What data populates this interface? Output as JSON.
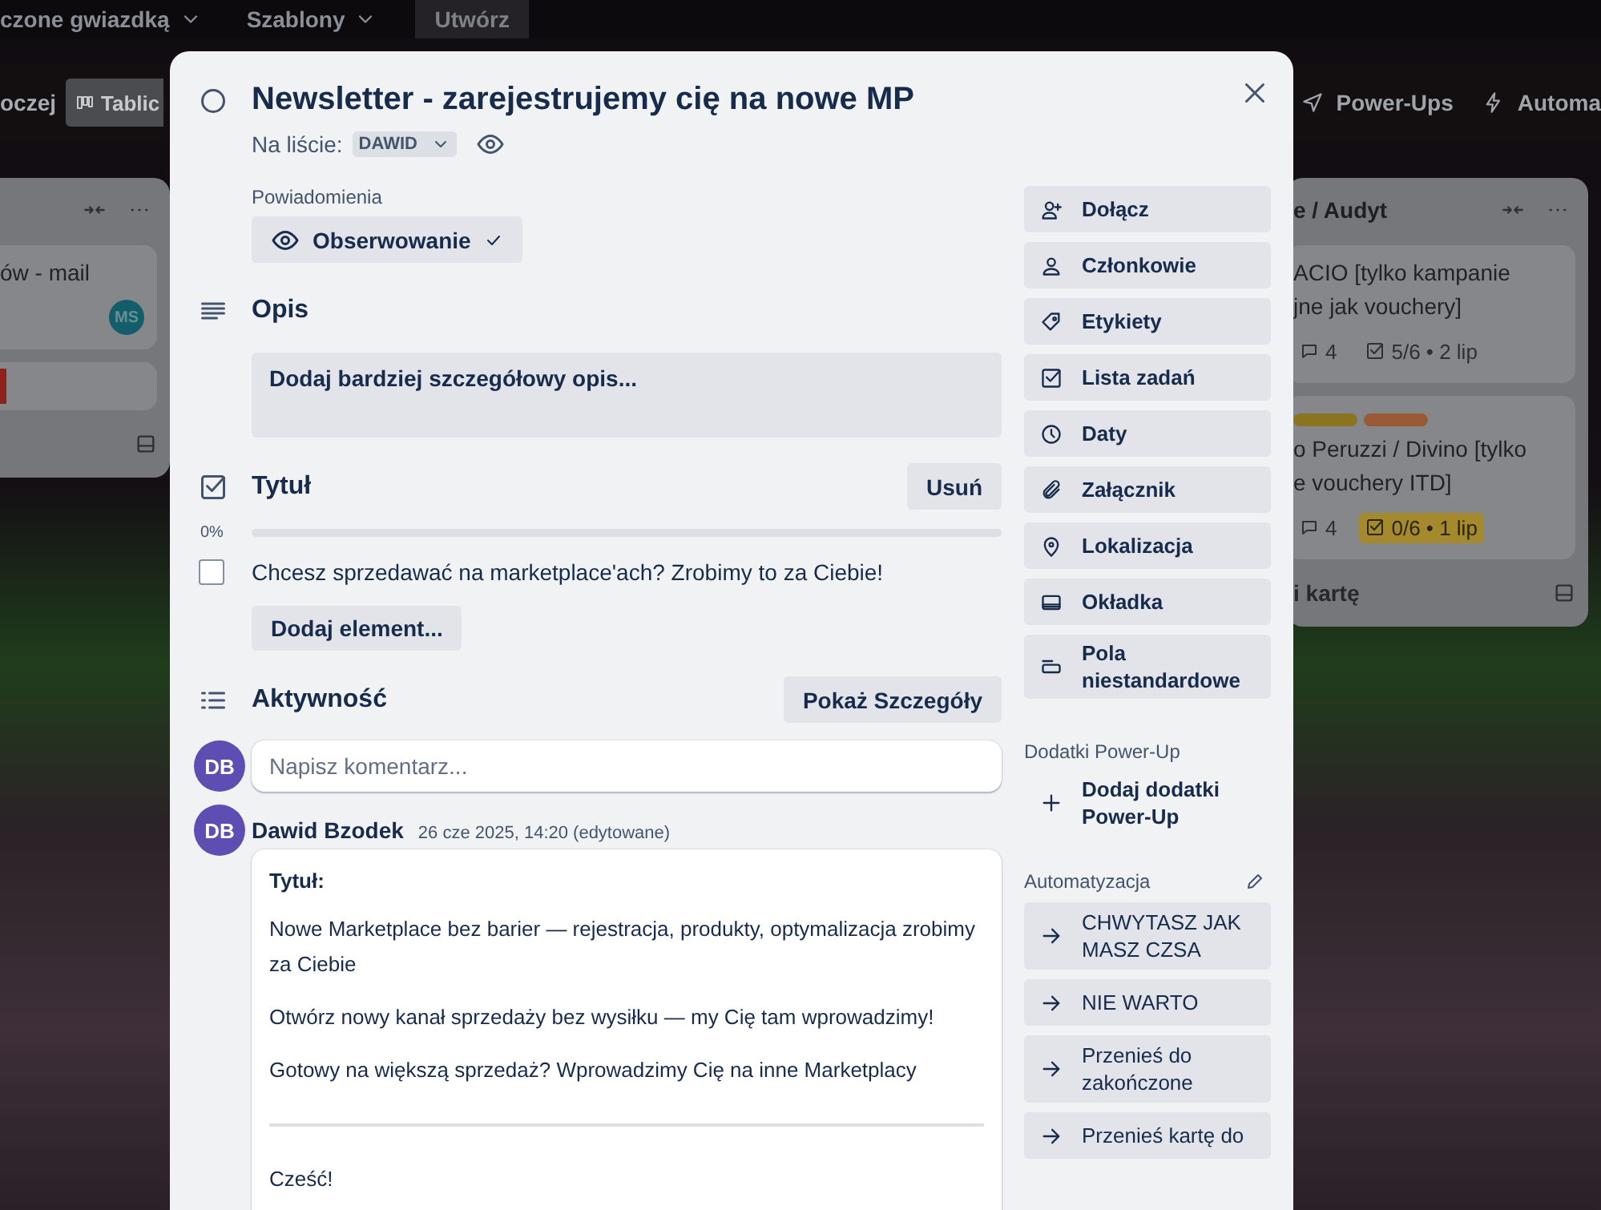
{
  "top_bar": {
    "items": [
      {
        "kind": "menu",
        "label": "czone gwiazdką"
      },
      {
        "kind": "menu",
        "label": "Szablony"
      },
      {
        "kind": "button",
        "label": "Utwórz"
      }
    ]
  },
  "board_header": {
    "view_label": "oczej",
    "view_button": "Tablic",
    "power_ups": "Power-Ups",
    "automation": "Automa"
  },
  "lists": [
    {
      "cards": [
        {
          "title_lines": [
            "ów - mail"
          ],
          "member": "MS"
        },
        {
          "labels": [
            {
              "color": "#8e2119"
            }
          ]
        }
      ]
    },
    {
      "title": "e / Audyt",
      "cards": [
        {
          "title_lines": [
            "ACIO [tylko kampanie",
            "jne jak vouchery]"
          ],
          "comments": "4",
          "checklist": "5/6 • 2 lip",
          "due_soon": false
        },
        {
          "labels": [
            {
              "color": "#8a7420"
            },
            {
              "color": "#9a5a36"
            }
          ],
          "title_lines": [
            "o Peruzzi / Divino [tylko",
            "e vouchery ITD]"
          ],
          "comments": "4",
          "checklist": "0/6 • 1 lip",
          "due_soon": true
        }
      ],
      "add_card": "i kartę"
    }
  ],
  "card": {
    "title": "Newsletter - zarejestrujemy cię na nowe MP",
    "completed": false,
    "list_label": "Na liście:",
    "list_name": "DAWID",
    "notifications": {
      "label": "Powiadomienia",
      "button": "Obserwowanie",
      "watching": true
    },
    "description": {
      "heading": "Opis",
      "placeholder": "Dodaj bardziej szczegółowy opis..."
    },
    "checklist": {
      "title": "Tytuł",
      "delete": "Usuń",
      "percent": "0%",
      "level": 0,
      "items": [
        {
          "text": "Chcesz sprzedawać na marketplace'ach? Zrobimy to za Ciebie!",
          "checked": false
        }
      ],
      "add": "Dodaj element..."
    },
    "activity": {
      "heading": "Aktywność",
      "details_button": "Pokaż Szczegóły",
      "input_avatar": "DB",
      "input_placeholder": "Napisz komentarz...",
      "comments": [
        {
          "avatar": "DB",
          "author": "Dawid Bzodek",
          "time": "26 cze 2025, 14:20 (edytowane)",
          "blocks": [
            {
              "kind": "heading",
              "text": "Tytuł:"
            },
            {
              "kind": "text",
              "text": "Nowe Marketplace bez barier — rejestracja, produkty, optymalizacja zrobimy za Ciebie"
            },
            {
              "kind": "text",
              "text": "Otwórz nowy kanał sprzedaży bez wysiłku — my Cię tam wprowadzimy!"
            },
            {
              "kind": "text",
              "text": "Gotowy na większą sprzedaż? Wprowadzimy Cię na inne Marketplacy"
            },
            {
              "kind": "rule"
            },
            {
              "kind": "text",
              "text": "Cześć!"
            }
          ]
        }
      ]
    },
    "actions": [
      "Dołącz",
      "Członkowie",
      "Etykiety",
      "Lista zadań",
      "Daty",
      "Załącznik",
      "Lokalizacja",
      "Okładka",
      "Pola niestandardowe"
    ],
    "power_ups": {
      "label": "Dodatki Power-Up",
      "button": "Dodaj dodatki Power-Up"
    },
    "automation": {
      "label": "Automatyzacja",
      "buttons": [
        "CHWYTASZ JAK MASZ CZSA",
        "NIE WARTO",
        "Przenieś do zakończone",
        "Przenieś kartę do"
      ]
    }
  }
}
